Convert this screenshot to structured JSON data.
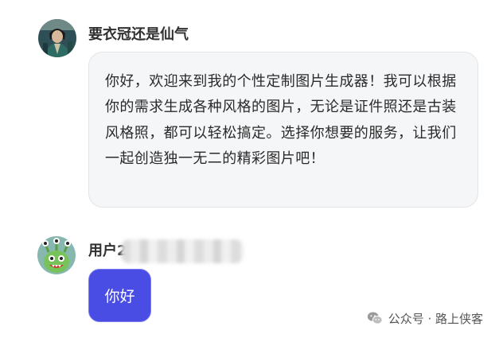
{
  "conversation": {
    "bot": {
      "name": "要衣冠还是仙气",
      "avatar_icon": "character-portrait-icon",
      "message": "你好，欢迎来到我的个性定制图片生成器！我可以根据你的需求生成各种风格的图片，无论是证件照还是古装风格照，都可以轻松搞定。选择你想要的服务，让我们一起创造独一无二的精彩图片吧！"
    },
    "user": {
      "name": "用户2",
      "avatar_icon": "green-monster-icon",
      "message": "你好",
      "bubble_color": "#4a4de4"
    }
  },
  "watermark": {
    "icon": "wechat-icon",
    "text": "公众号 · 路上侠客"
  }
}
